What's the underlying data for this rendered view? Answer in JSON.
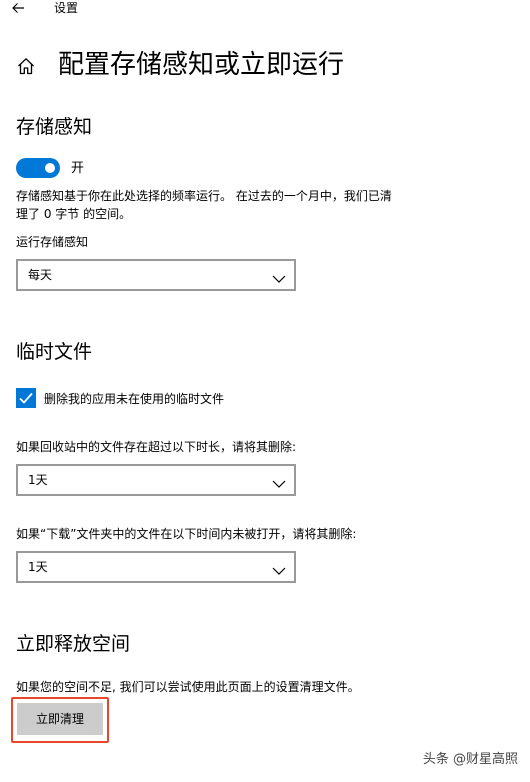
{
  "window": {
    "title": "设置"
  },
  "page": {
    "title": "配置存储感知或立即运行"
  },
  "storage_sense": {
    "heading": "存储感知",
    "toggle_state": "开",
    "toggle_on": true,
    "description_line1": "存储感知基于你在此处选择的频率运行。 在过去的一个月中，我们已清",
    "description_line2": "理了 0 字节 的空间。",
    "run_label": "运行存储感知",
    "run_value": "每天"
  },
  "temp_files": {
    "heading": "临时文件",
    "checkbox_label": "删除我的应用未在使用的临时文件",
    "checkbox_checked": true,
    "recycle_label": "如果回收站中的文件存在超过以下时长，请将其删除:",
    "recycle_value": "1天",
    "downloads_label": "如果“下载”文件夹中的文件在以下时间内未被打开，请将其删除:",
    "downloads_value": "1天"
  },
  "free_space": {
    "heading": "立即释放空间",
    "description": "如果您的空间不足, 我们可以尝试使用此页面上的设置清理文件。",
    "button_label": "立即清理"
  },
  "watermark": {
    "text": "头条 @财星高照"
  },
  "colors": {
    "accent": "#0078d7",
    "highlight_border": "#e8472e",
    "button_bg": "#cccccc"
  },
  "icons": {
    "back": "back-arrow-icon",
    "home": "home-icon",
    "chevron": "chevron-down-icon",
    "checkmark": "checkmark-icon"
  }
}
